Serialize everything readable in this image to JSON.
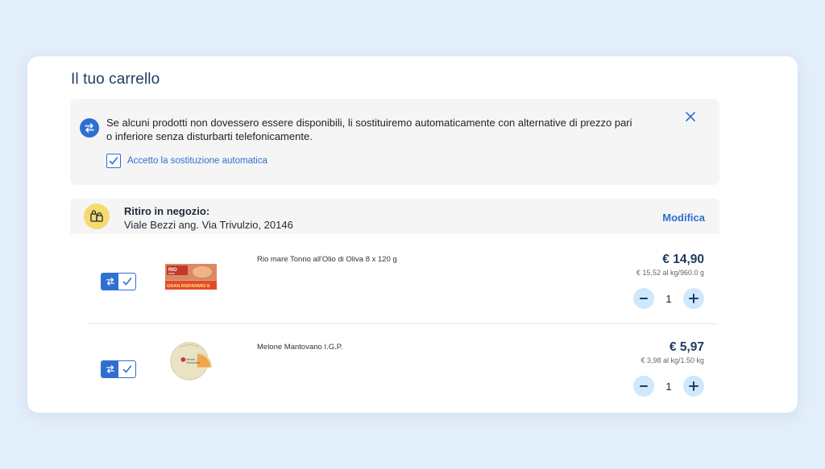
{
  "cart": {
    "title": "Il tuo carrello"
  },
  "notice": {
    "text": "Se alcuni prodotti non dovessero essere disponibili, li sostituiremo automaticamente con alternative di prezzo pari o inferiore senza disturbarti telefonicamente.",
    "checkbox_label": "Accetto la sostituzione automatica",
    "checkbox_checked": true,
    "icon": "swap-icon",
    "close_icon": "close-icon"
  },
  "store": {
    "title": "Ritiro in negozio:",
    "address": "Viale Bezzi ang. Via Trivulzio, 20146",
    "modify_label": "Modifica",
    "icon": "store-bags-icon"
  },
  "items": [
    {
      "name": "Rio mare Tonno all'Olio di Oliva 8 x 120 g",
      "price": "€ 14,90",
      "unit_price": "€ 15,52 al kg/960.0 g",
      "quantity": "1",
      "image_text": "RIO mare — GRAN RISPARMIO 8"
    },
    {
      "name": "Melone Mantovano I.G.P.",
      "price": "€ 5,97",
      "unit_price": "€ 3,98 al kg/1.50 kg",
      "quantity": "1",
      "image_text": "Melone Mantovano"
    }
  ],
  "colors": {
    "accent": "#2f6fd1",
    "title": "#1f3a5f",
    "stepper_bg": "#cfe8fb",
    "store_icon_bg": "#f6da70",
    "page_bg": "#e3eefb"
  }
}
